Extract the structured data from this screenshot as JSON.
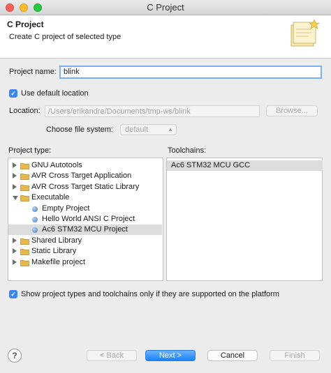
{
  "window": {
    "title": "C Project"
  },
  "header": {
    "title": "C Project",
    "description": "Create C project of selected type",
    "graphic_icon": "wizard-banner-icon"
  },
  "form": {
    "project_name_label": "Project name:",
    "project_name_value": "blink",
    "use_default_location_label": "Use default location",
    "use_default_location_checked": true,
    "location_label": "Location:",
    "location_value": "/Users/erikandre/Documents/tmp-ws/blink",
    "browse_label": "Browse...",
    "file_system_label": "Choose file system:",
    "file_system_value": "default"
  },
  "project_type": {
    "label": "Project type:",
    "items": [
      {
        "label": "GNU Autotools",
        "expander": "closed",
        "icon": "folder-icon"
      },
      {
        "label": "AVR Cross Target Application",
        "expander": "closed",
        "icon": "folder-icon"
      },
      {
        "label": "AVR Cross Target Static Library",
        "expander": "closed",
        "icon": "folder-icon"
      },
      {
        "label": "Executable",
        "expander": "open",
        "icon": "folder-icon"
      },
      {
        "label": "Empty Project",
        "icon": "bullet-icon"
      },
      {
        "label": "Hello World ANSI C Project",
        "icon": "bullet-icon"
      },
      {
        "label": "Ac6 STM32 MCU Project",
        "icon": "bullet-icon",
        "selected": true
      },
      {
        "label": "Shared Library",
        "expander": "closed",
        "icon": "folder-icon"
      },
      {
        "label": "Static Library",
        "expander": "closed",
        "icon": "folder-icon"
      },
      {
        "label": "Makefile project",
        "expander": "closed",
        "icon": "folder-icon"
      }
    ]
  },
  "toolchains": {
    "label": "Toolchains:",
    "items": [
      {
        "label": "Ac6 STM32 MCU GCC",
        "selected": true
      }
    ]
  },
  "filter": {
    "label": "Show project types and toolchains only if they are supported on the platform",
    "checked": true
  },
  "footer": {
    "help_icon": "help-icon",
    "back_label": "< Back",
    "next_label": "Next >",
    "cancel_label": "Cancel",
    "finish_label": "Finish"
  },
  "colors": {
    "accent": "#3b86f0",
    "primary_button": "#1a82fb",
    "selection": "#dcdcdc",
    "folder": "#e8b84a"
  }
}
